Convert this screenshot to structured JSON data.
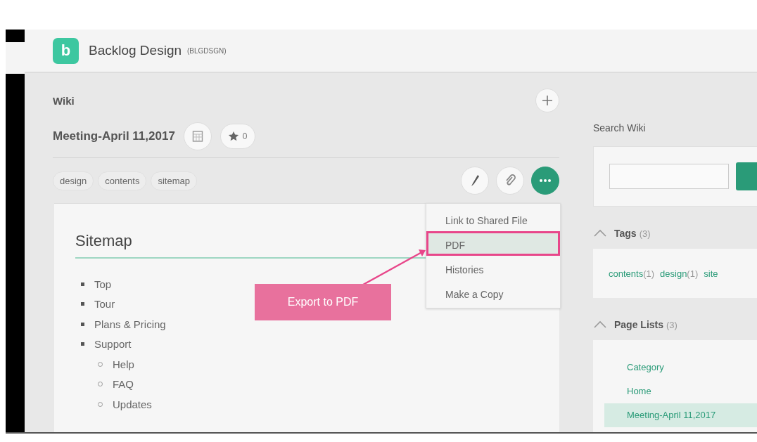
{
  "project": {
    "logo_letter": "b",
    "name": "Backlog Design",
    "key": "(BLGDSGN)"
  },
  "wiki": {
    "section_title": "Wiki",
    "page_title": "Meeting-April 11,2017",
    "star_count": "0",
    "tags": [
      "design",
      "contents",
      "sitemap"
    ]
  },
  "more_menu": {
    "expanded": true,
    "items": [
      {
        "label": "Link to Shared File",
        "selected": false
      },
      {
        "label": "PDF",
        "selected": true
      },
      {
        "label": "Histories",
        "selected": false
      },
      {
        "label": "Make a Copy",
        "selected": false
      }
    ]
  },
  "callout": {
    "text": "Export to PDF"
  },
  "content": {
    "heading": "Sitemap",
    "items": [
      {
        "label": "Top"
      },
      {
        "label": "Tour"
      },
      {
        "label": "Plans & Pricing"
      },
      {
        "label": "Support",
        "children": [
          {
            "label": "Help"
          },
          {
            "label": "FAQ"
          },
          {
            "label": "Updates"
          }
        ]
      }
    ]
  },
  "sidebar": {
    "search_title": "Search Wiki",
    "tags_section": {
      "title": "Tags",
      "count": "(3)",
      "expanded": true,
      "items": [
        {
          "label": "contents",
          "count": "(1)"
        },
        {
          "label": "design",
          "count": "(1)"
        },
        {
          "label": "site"
        }
      ]
    },
    "pages_section": {
      "title": "Page Lists",
      "count": "(3)",
      "expanded": true,
      "items": [
        {
          "label": "Category",
          "selected": false
        },
        {
          "label": "Home",
          "selected": false
        },
        {
          "label": "Meeting-April 11,2017",
          "selected": true
        }
      ]
    }
  }
}
